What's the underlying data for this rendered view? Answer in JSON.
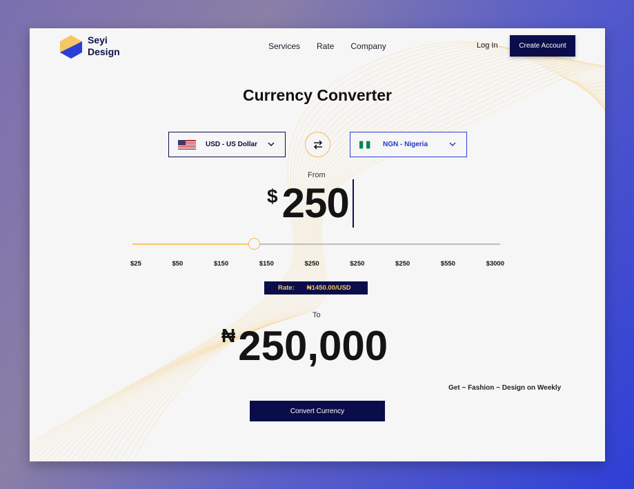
{
  "brand": {
    "name_line1": "Seyi",
    "name_line2": "Design"
  },
  "nav": {
    "items": [
      "Services",
      "Rate",
      "Company"
    ]
  },
  "auth": {
    "login": "Log In",
    "create_account": "Create Account"
  },
  "title": "Currency Converter",
  "from_currency": {
    "label": "USD - US Dollar",
    "flag": "us-flag-icon"
  },
  "to_currency": {
    "label": "NGN - Nigeria",
    "flag": "ng-flag-icon"
  },
  "from": {
    "label": "From",
    "symbol": "$",
    "amount": "250"
  },
  "slider": {
    "ticks": [
      "$25",
      "$50",
      "$150",
      "$150",
      "$250",
      "$250",
      "$250",
      "$550",
      "$3000"
    ],
    "value_fraction": 0.33
  },
  "rate": {
    "label": "Rate:",
    "value": "₦1450.00/USD"
  },
  "to": {
    "label": "To",
    "symbol": "₦",
    "amount": "250,000"
  },
  "promo": "Get ~ Fashion ~ Design on Weekly",
  "convert_button": "Convert Currency",
  "colors": {
    "navy": "#0b0d4a",
    "accent": "#f5b94a",
    "blue": "#2b3fd6"
  }
}
